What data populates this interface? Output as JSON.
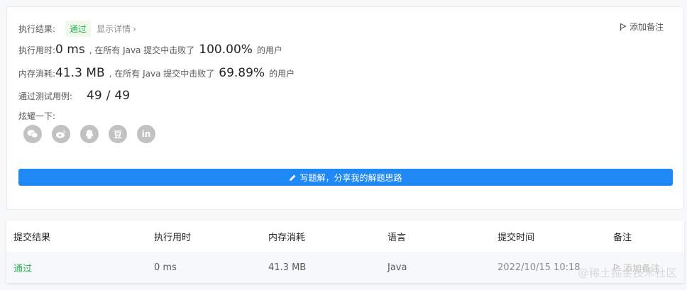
{
  "result": {
    "label": "执行结果:",
    "status": "通过",
    "detail_link": "显示详情",
    "detail_chevron": "›",
    "add_note": "添加备注"
  },
  "runtime": {
    "label": "执行用时:",
    "value": "0 ms",
    "mid_text": ", 在所有 Java 提交中击败了",
    "percent": "100.00%",
    "suffix": "的用户"
  },
  "memory": {
    "label": "内存消耗:",
    "value": "41.3 MB",
    "mid_text": ", 在所有 Java 提交中击败了",
    "percent": "69.89%",
    "suffix": "的用户"
  },
  "tests": {
    "label": "通过测试用例:",
    "passed": "49",
    "divider": "/",
    "total": "49"
  },
  "share": {
    "label": "炫耀一下:",
    "icons": [
      "wechat-icon",
      "weibo-icon",
      "qq-icon",
      "douban-icon",
      "linkedin-icon"
    ],
    "douban_glyph": "豆",
    "linkedin_glyph": "in"
  },
  "write_solution": {
    "label": "写题解，分享我的解题思路",
    "icon": "pencil-icon"
  },
  "submissions": {
    "headers": [
      "提交结果",
      "执行用时",
      "内存消耗",
      "语言",
      "提交时间",
      "备注"
    ],
    "rows": [
      {
        "status": "通过",
        "runtime": "0 ms",
        "memory": "41.3 MB",
        "language": "Java",
        "time": "2022/10/15 10:18",
        "note": "添加备注"
      }
    ]
  },
  "watermark": "@稀土掘金技术社区",
  "colors": {
    "accent": "#1e88f5",
    "success": "#2db55d",
    "icon_gray": "#c2c2c2"
  }
}
